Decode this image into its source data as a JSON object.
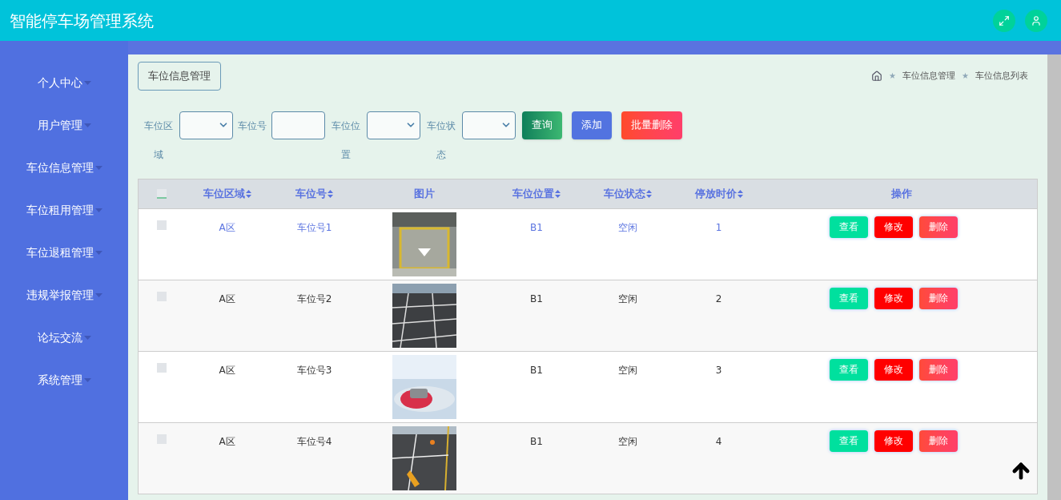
{
  "header": {
    "title": "智能停车场管理系统"
  },
  "sidebar": {
    "items": [
      {
        "label": "个人中心"
      },
      {
        "label": "用户管理"
      },
      {
        "label": "车位信息管理"
      },
      {
        "label": "车位租用管理"
      },
      {
        "label": "车位退租管理"
      },
      {
        "label": "违规举报管理"
      },
      {
        "label": "论坛交流"
      },
      {
        "label": "系统管理"
      }
    ]
  },
  "page_tab": "车位信息管理",
  "breadcrumb": {
    "separator": "★",
    "items": [
      "车位信息管理",
      "车位信息列表"
    ]
  },
  "filters": [
    {
      "label": "车位区域",
      "kind": "select"
    },
    {
      "label": "车位号",
      "kind": "input"
    },
    {
      "label": "车位位置",
      "kind": "select"
    },
    {
      "label": "车位状态",
      "kind": "select"
    }
  ],
  "buttons": [
    {
      "label": "查询",
      "kind": "search"
    },
    {
      "label": "添加",
      "kind": "add"
    },
    {
      "label": "批量删除",
      "kind": "delete"
    }
  ],
  "table": {
    "all_checked": false,
    "columns": [
      {
        "label": "车位区域",
        "sortable": true
      },
      {
        "label": "车位号",
        "sortable": true
      },
      {
        "label": "图片",
        "sortable": false
      },
      {
        "label": "车位位置",
        "sortable": true
      },
      {
        "label": "车位状态",
        "sortable": true
      },
      {
        "label": "停放时价",
        "sortable": true
      },
      {
        "label": "操作",
        "sortable": false
      }
    ],
    "rows": [
      {
        "cells": [
          "A区",
          "车位号1",
          {
            "kind": "picture"
          },
          "B1",
          "空闲",
          "1"
        ],
        "checked": false,
        "hovered": true,
        "actions": [
          "查看",
          "修改",
          "删除"
        ]
      },
      {
        "cells": [
          "A区",
          "车位号2",
          {
            "kind": "picture"
          },
          "B1",
          "空闲",
          "2"
        ],
        "checked": false,
        "hovered": false,
        "actions": [
          "查看",
          "修改",
          "删除"
        ]
      },
      {
        "cells": [
          "A区",
          "车位号3",
          {
            "kind": "picture"
          },
          "B1",
          "空闲",
          "3"
        ],
        "checked": false,
        "hovered": false,
        "actions": [
          "查看",
          "修改",
          "删除"
        ]
      },
      {
        "cells": [
          "A区",
          "车位号4",
          {
            "kind": "picture"
          },
          "B1",
          "空闲",
          "4"
        ],
        "checked": false,
        "hovered": false,
        "actions": [
          "查看",
          "修改",
          "删除"
        ]
      }
    ]
  }
}
